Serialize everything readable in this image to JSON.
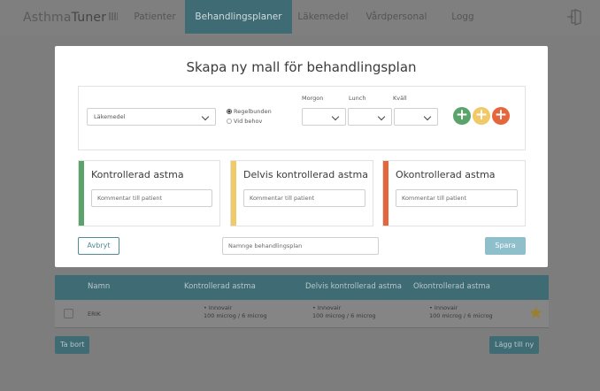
{
  "app": {
    "logo_part1": "Asthma",
    "logo_part2": "Tuner",
    "nav": [
      "Patienter",
      "Behandlingsplaner",
      "Läkemedel",
      "Vårdpersonal",
      "Logg"
    ],
    "active_nav": "Behandlingsplaner"
  },
  "colors": {
    "accent": "#3f6b74",
    "green": "#5aa36a",
    "yellow": "#f0c969",
    "orange": "#e5663d"
  },
  "table": {
    "headers": [
      "Namn",
      "Kontrollerad astma",
      "Delvis kontrollerad astma",
      "Okontrollerad astma"
    ],
    "rows": [
      {
        "name": "ERIK",
        "kontrollerad": {
          "drug": "Innovair",
          "dose": "100 microg / 6 microg"
        },
        "delvis": {
          "drug": "Innovair",
          "dose": "100 microg / 6 microg"
        },
        "okontrollerad": {
          "drug": "Innovair",
          "dose": "100 microg / 6 microg"
        }
      }
    ]
  },
  "buttons": {
    "delete": "Ta bort",
    "add_new": "Lägg till ny"
  },
  "modal": {
    "title": "Skapa ny mall för behandlingsplan",
    "medicine_placeholder": "Läkemedel",
    "radio_regular": "Regelbunden",
    "radio_as_needed": "Vid behov",
    "times": [
      "Morgon",
      "Lunch",
      "Kväll"
    ],
    "cards": [
      {
        "title": "Kontrollerad astma",
        "placeholder": "Kommentar till patient"
      },
      {
        "title": "Delvis kontrollerad astma",
        "placeholder": "Kommentar till patient"
      },
      {
        "title": "Okontrollerad astma",
        "placeholder": "Kommentar till patient"
      }
    ],
    "cancel": "Avbryt",
    "name_placeholder": "Namnge behandlingsplan",
    "save": "Spara"
  }
}
